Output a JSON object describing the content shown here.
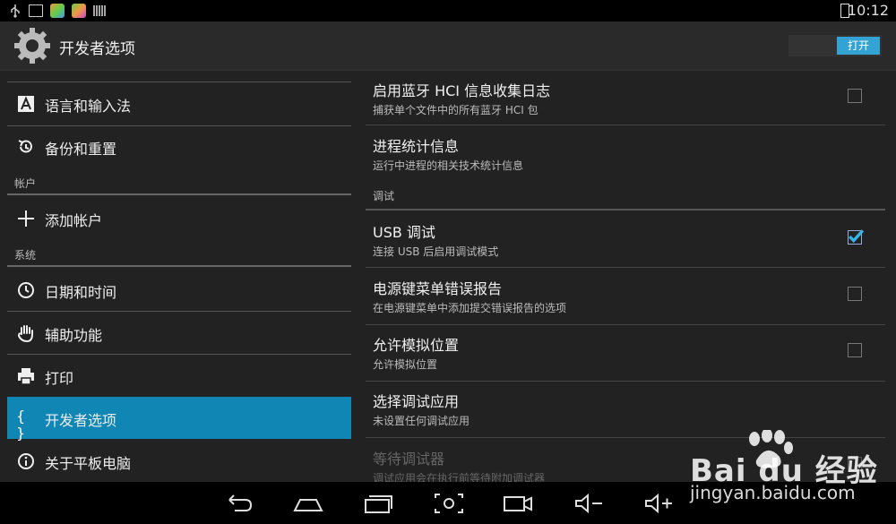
{
  "statusbar": {
    "time": "10:12"
  },
  "actionbar": {
    "title": "开发者选项",
    "toggle_label": "打开"
  },
  "left": {
    "items": [
      {
        "label": "语言和输入法",
        "icon": "language-icon"
      },
      {
        "label": "备份和重置",
        "icon": "backup-icon"
      },
      {
        "label": "添加帐户",
        "icon": "add-icon"
      },
      {
        "label": "日期和时间",
        "icon": "clock-icon"
      },
      {
        "label": "辅助功能",
        "icon": "hand-icon"
      },
      {
        "label": "打印",
        "icon": "printer-icon"
      },
      {
        "label": "开发者选项",
        "icon": "braces-icon",
        "selected": true
      },
      {
        "label": "关于平板电脑",
        "icon": "info-icon"
      }
    ],
    "section_accounts": "帐户",
    "section_system": "系统"
  },
  "right": {
    "prefs": [
      {
        "title": "启用蓝牙 HCI 信息收集日志",
        "summary": "捕获单个文件中的所有蓝牙 HCI 包",
        "checked": false
      },
      {
        "title": "进程统计信息",
        "summary": "运行中进程的相关技术统计信息"
      },
      {
        "title": "USB 调试",
        "summary": "连接 USB 后启用调试模式",
        "checked": true
      },
      {
        "title": "电源键菜单错误报告",
        "summary": "在电源键菜单中添加提交错误报告的选项",
        "checked": false
      },
      {
        "title": "允许模拟位置",
        "summary": "允许模拟位置",
        "checked": false
      },
      {
        "title": "选择调试应用",
        "summary": "未设置任何调试应用"
      },
      {
        "title": "等待调试器",
        "summary": "调试应用会在执行前等待附加调试器",
        "checked": false,
        "disabled": true
      }
    ],
    "section_debug": "调试"
  },
  "watermark": {
    "brand": "Bai du 经验",
    "url": "jingyan.baidu.com"
  },
  "colors": {
    "accent": "#33a3d4",
    "selected": "#0f86b4"
  }
}
